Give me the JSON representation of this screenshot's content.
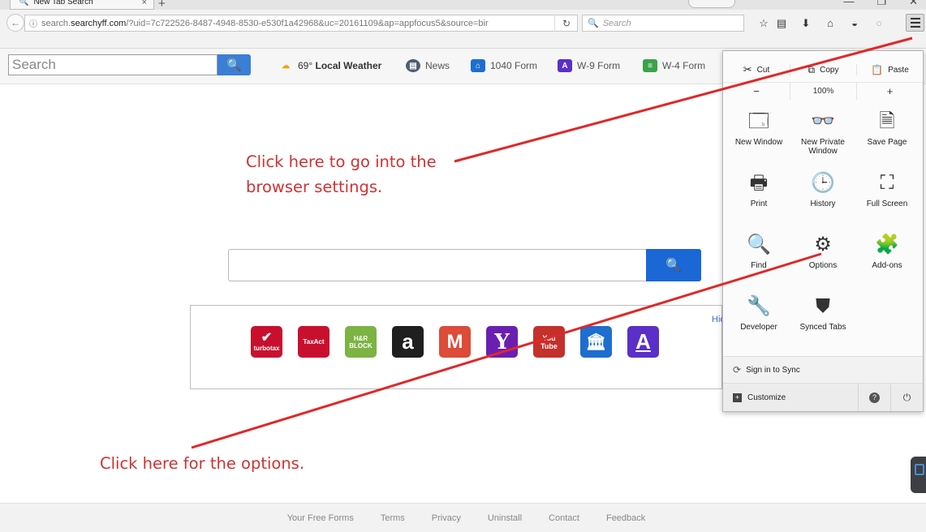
{
  "browser": {
    "tab": {
      "title": "New Tab Search",
      "close_glyph": "×"
    },
    "new_tab_glyph": "+",
    "window_controls": [
      "—",
      "❐",
      "✕"
    ],
    "url": {
      "prefix": "search.",
      "domain": "searchyff.com",
      "rest": "/?uid=7c722526-8487-4948-8530-e530f1a42968&uc=20161109&ap=appfocus5&source=bir"
    },
    "reload_glyph": "↻",
    "search_placeholder": "Search"
  },
  "pagebar": {
    "search_placeholder": "Search",
    "links": [
      {
        "label_temp": "69°",
        "label_bold": "Local Weather",
        "icon": "weather-icon"
      },
      {
        "label": "News",
        "icon": "news-icon"
      },
      {
        "label": "1040 Form",
        "icon": "bank-icon"
      },
      {
        "label": "W-9 Form",
        "icon": "form-a-icon"
      },
      {
        "label": "W-4 Form",
        "icon": "doc-icon"
      }
    ]
  },
  "annotations": {
    "settings_line1": "Click here to go into the",
    "settings_line2": "browser settings.",
    "options": "Click here for the options."
  },
  "main": {
    "hide_text": "Hic",
    "tiles": [
      {
        "name": "turbotax",
        "text": "turbotax",
        "color": "#c8102e"
      },
      {
        "name": "taxact",
        "text": "TaxAct",
        "color": "#c8102e"
      },
      {
        "name": "hr-block",
        "text": "H&R BLOCK",
        "color": "#7cb342"
      },
      {
        "name": "amazon",
        "text": "a",
        "color": "#1f1f1f"
      },
      {
        "name": "gmail",
        "text": "M",
        "color": "#dd4b39"
      },
      {
        "name": "yahoo",
        "text": "Y",
        "color": "#6b1fb1"
      },
      {
        "name": "youtube",
        "text": "You Tube",
        "color": "#c4302b"
      },
      {
        "name": "bank",
        "text": "🏛",
        "color": "#1e6ecf"
      },
      {
        "name": "form-a",
        "text": "A",
        "color": "#5b2fc8"
      }
    ]
  },
  "footer": [
    "Your Free Forms",
    "Terms",
    "Privacy",
    "Uninstall",
    "Contact",
    "Feedback"
  ],
  "menu": {
    "cut": "Cut",
    "copy": "Copy",
    "paste": "Paste",
    "zoom_out": "−",
    "zoom_level": "100%",
    "zoom_in": "+",
    "items": [
      {
        "name": "new-window",
        "label": "New Window",
        "icon": "🗔"
      },
      {
        "name": "new-private-window",
        "label": "New Private Window",
        "icon": "👓"
      },
      {
        "name": "save-page",
        "label": "Save Page",
        "icon": "🗎"
      },
      {
        "name": "print",
        "label": "Print",
        "icon": "🖶"
      },
      {
        "name": "history",
        "label": "History",
        "icon": "🕒"
      },
      {
        "name": "full-screen",
        "label": "Full Screen",
        "icon": "⛶"
      },
      {
        "name": "find",
        "label": "Find",
        "icon": "🔍"
      },
      {
        "name": "options",
        "label": "Options",
        "icon": "⚙"
      },
      {
        "name": "add-ons",
        "label": "Add-ons",
        "icon": "🧩"
      },
      {
        "name": "developer",
        "label": "Developer",
        "icon": "🔧"
      },
      {
        "name": "synced-tabs",
        "label": "Synced Tabs",
        "icon": "⛊"
      }
    ],
    "sign_in": "Sign in to Sync",
    "customize": "Customize",
    "help_glyph": "?",
    "quit_glyph": "⏻"
  }
}
